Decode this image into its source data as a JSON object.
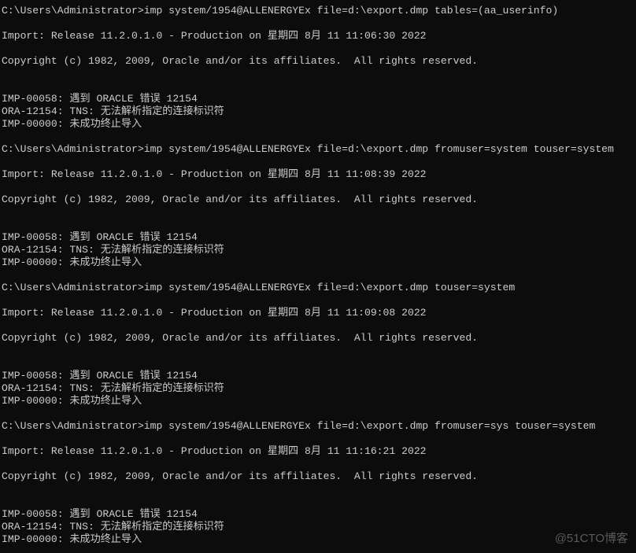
{
  "window": {
    "background": "#0c0c0c",
    "foreground": "#cccccc"
  },
  "console": {
    "lines": [
      "C:\\Users\\Administrator>imp system/1954@ALLENERGYEx file=d:\\export.dmp tables=(aa_userinfo)",
      "",
      "Import: Release 11.2.0.1.0 - Production on 星期四 8月 11 11:06:30 2022",
      "",
      "Copyright (c) 1982, 2009, Oracle and/or its affiliates.  All rights reserved.",
      "",
      "",
      "IMP-00058: 遇到 ORACLE 错误 12154",
      "ORA-12154: TNS: 无法解析指定的连接标识符",
      "IMP-00000: 未成功终止导入",
      "",
      "C:\\Users\\Administrator>imp system/1954@ALLENERGYEx file=d:\\export.dmp fromuser=system touser=system",
      "",
      "Import: Release 11.2.0.1.0 - Production on 星期四 8月 11 11:08:39 2022",
      "",
      "Copyright (c) 1982, 2009, Oracle and/or its affiliates.  All rights reserved.",
      "",
      "",
      "IMP-00058: 遇到 ORACLE 错误 12154",
      "ORA-12154: TNS: 无法解析指定的连接标识符",
      "IMP-00000: 未成功终止导入",
      "",
      "C:\\Users\\Administrator>imp system/1954@ALLENERGYEx file=d:\\export.dmp touser=system",
      "",
      "Import: Release 11.2.0.1.0 - Production on 星期四 8月 11 11:09:08 2022",
      "",
      "Copyright (c) 1982, 2009, Oracle and/or its affiliates.  All rights reserved.",
      "",
      "",
      "IMP-00058: 遇到 ORACLE 错误 12154",
      "ORA-12154: TNS: 无法解析指定的连接标识符",
      "IMP-00000: 未成功终止导入",
      "",
      "C:\\Users\\Administrator>imp system/1954@ALLENERGYEx file=d:\\export.dmp fromuser=sys touser=system",
      "",
      "Import: Release 11.2.0.1.0 - Production on 星期四 8月 11 11:16:21 2022",
      "",
      "Copyright (c) 1982, 2009, Oracle and/or its affiliates.  All rights reserved.",
      "",
      "",
      "IMP-00058: 遇到 ORACLE 错误 12154",
      "ORA-12154: TNS: 无法解析指定的连接标识符",
      "IMP-00000: 未成功终止导入"
    ]
  },
  "watermark": "@51CTO博客"
}
